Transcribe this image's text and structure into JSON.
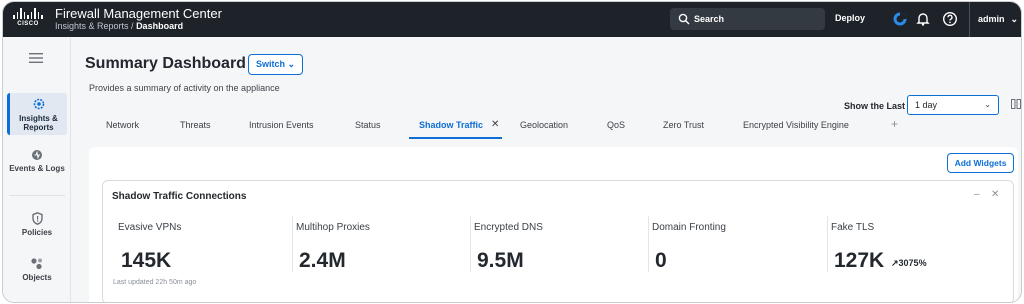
{
  "header": {
    "brand_word": "CISCO",
    "app_title": "Firewall Management Center",
    "breadcrumb_parent": "Insights & Reports /",
    "breadcrumb_current": "Dashboard",
    "search_label": "Search",
    "deploy_label": "Deploy",
    "user_label": "admin",
    "icons": [
      "search-icon",
      "status-icon",
      "bell-icon",
      "help-icon",
      "chevron-down-icon"
    ]
  },
  "sidebar": {
    "items": [
      {
        "label_line1": "Insights &",
        "label_line2": "Reports",
        "icon": "gear-cluster-icon",
        "active": true
      },
      {
        "label_line1": "Events & Logs",
        "label_line2": "",
        "icon": "events-icon",
        "active": false
      },
      {
        "label_line1": "Policies",
        "label_line2": "",
        "icon": "shield-icon",
        "active": false
      },
      {
        "label_line1": "Objects",
        "label_line2": "",
        "icon": "objects-icon",
        "active": false
      }
    ]
  },
  "page": {
    "title": "Summary Dashboard",
    "switch_label": "Switch",
    "subtitle": "Provides a summary of activity on the appliance",
    "show_last_label": "Show the Last",
    "time_range": "1 day"
  },
  "tabs": [
    {
      "label": "Network"
    },
    {
      "label": "Threats"
    },
    {
      "label": "Intrusion Events"
    },
    {
      "label": "Status"
    },
    {
      "label": "Shadow Traffic",
      "active": true
    },
    {
      "label": "Geolocation"
    },
    {
      "label": "QoS"
    },
    {
      "label": "Zero Trust"
    },
    {
      "label": "Encrypted Visibility Engine"
    }
  ],
  "toolbar": {
    "add_widgets_label": "Add Widgets"
  },
  "widget": {
    "title": "Shadow Traffic Connections",
    "metrics": [
      {
        "label": "Evasive VPNs",
        "value": "145K",
        "trend": ""
      },
      {
        "label": "Multihop Proxies",
        "value": "2.4M",
        "trend": ""
      },
      {
        "label": "Encrypted DNS",
        "value": "9.5M",
        "trend": ""
      },
      {
        "label": "Domain Fronting",
        "value": "0",
        "trend": ""
      },
      {
        "label": "Fake TLS",
        "value": "127K",
        "trend": "↗3075%"
      }
    ],
    "last_updated": "Last updated 22h 50m ago"
  },
  "colors": {
    "topbar": "#1e2229",
    "accent": "#0d6ed6",
    "sidebar_active": "#e1e8f2"
  }
}
